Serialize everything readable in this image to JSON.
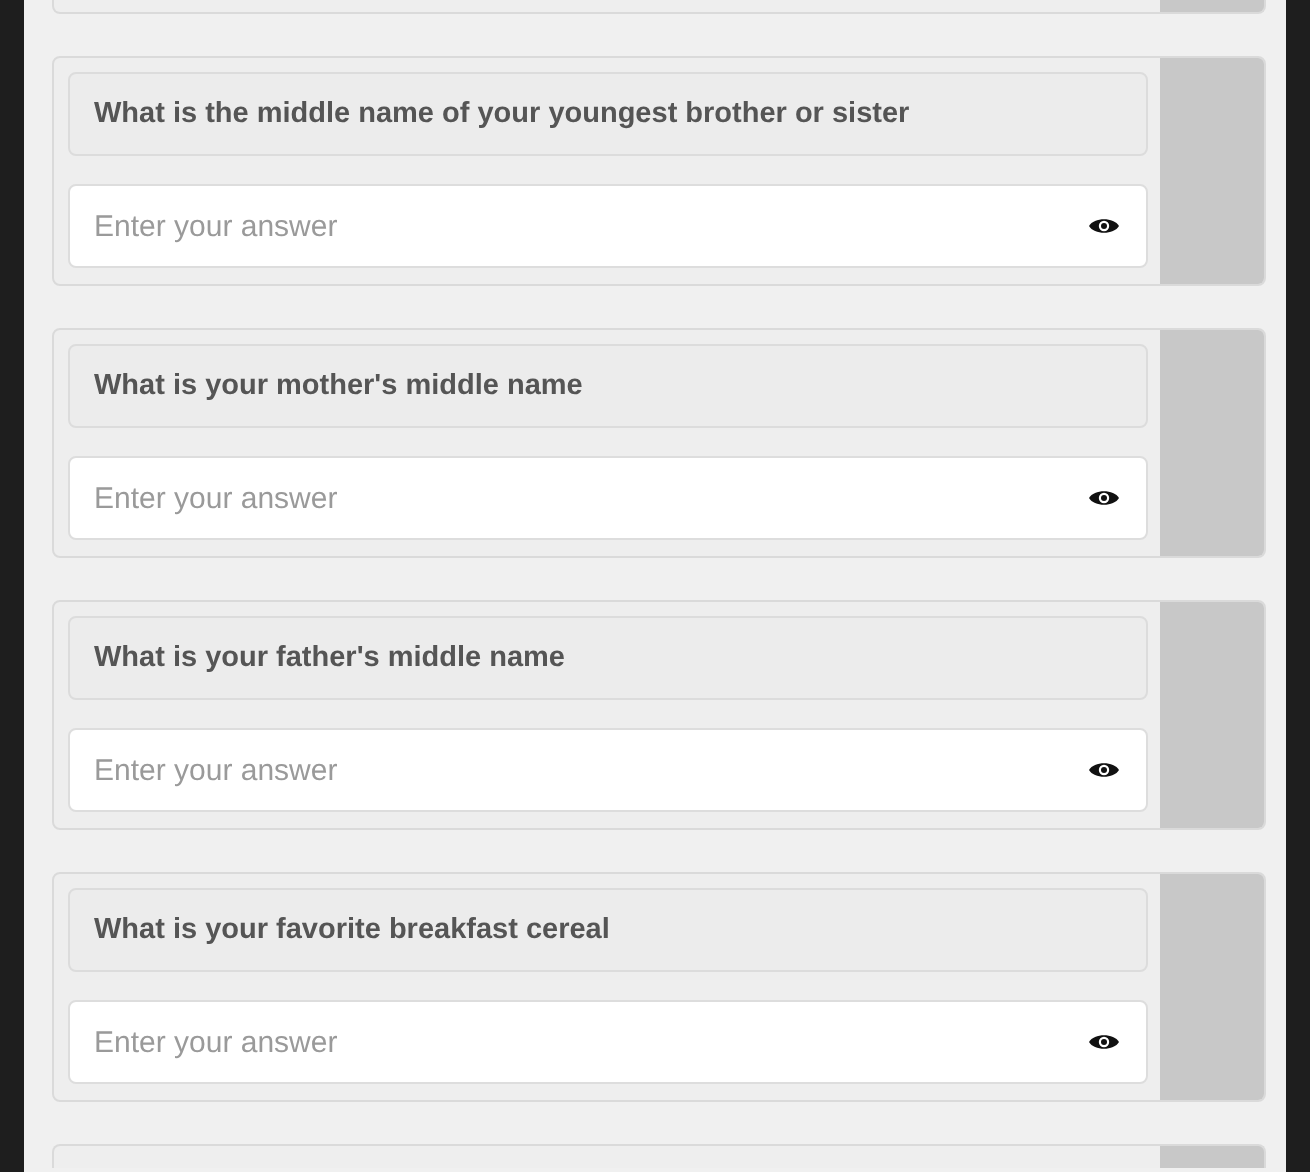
{
  "questions": [
    {
      "label": "What is the middle name of your youngest brother or sister",
      "placeholder": "Enter your answer"
    },
    {
      "label": "What is your mother's middle name",
      "placeholder": "Enter your answer"
    },
    {
      "label": "What is your father's middle name",
      "placeholder": "Enter your answer"
    },
    {
      "label": "What is your favorite breakfast cereal",
      "placeholder": "Enter your answer"
    }
  ]
}
